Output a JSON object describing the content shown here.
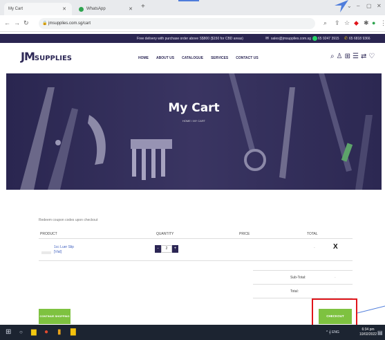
{
  "browser": {
    "tabs": [
      {
        "label": "My Cart"
      },
      {
        "label": "WhatsApp"
      }
    ],
    "new_tab": "+",
    "url": "jmsupplies.com.sg/cart",
    "window_controls": [
      "⌄",
      "–",
      "▢",
      "✕"
    ]
  },
  "promo_bar": {
    "message": "Free delivery with purchase order above S$800 ($150 for CBD areas)",
    "email": "sales@jmsupplies.com.sg",
    "phone1": "65 9247 3915",
    "phone2": "65 6818 9366"
  },
  "header": {
    "logo_mark": "JM",
    "logo_text": "SUPPLIES",
    "nav": [
      "HOME",
      "ABOUT US",
      "CATALOGUE",
      "SERVICES",
      "CONTACT US"
    ]
  },
  "hero": {
    "title": "My Cart",
    "breadcrumb": "HOME  /  MY CART"
  },
  "cart": {
    "notice": "Redeem coupon codes upon checkout",
    "columns": [
      "PRODUCT",
      "QUANTITY",
      "PRICE",
      "TOTAL"
    ],
    "items": [
      {
        "name": "1cc Luer Slip",
        "variant": "[Vial]",
        "quantity": "2",
        "total": "-",
        "remove": "X"
      }
    ],
    "subtotal_label": "Sub-Total:",
    "subtotal_value": "-",
    "total_label": "Total:",
    "total_value": "-",
    "continue_label": "CONTINUE SHOPPING",
    "checkout_label": "CHECKOUT"
  },
  "taskbar": {
    "tray": "^ 𝄞 ENG",
    "time": "6:34 pm",
    "date": "10/02/2022"
  },
  "colors": {
    "brand_navy": "#2a2550",
    "accent_green": "#7ec240",
    "highlight_red": "#e0141a"
  }
}
